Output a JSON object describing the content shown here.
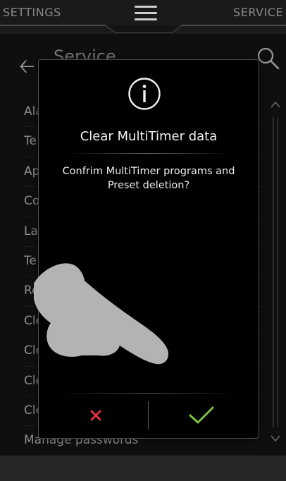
{
  "topbar": {
    "left_tab": "SETTINGS",
    "right_tab": "SERVICE",
    "menu_icon": "hamburger-menu-icon"
  },
  "background": {
    "back_icon": "back-arrow-icon",
    "title": "Service",
    "search_icon": "search-icon",
    "list_items": [
      "Ala",
      "Te",
      "Ap",
      "Co",
      "La",
      "Te",
      "Re",
      "Cle",
      "Cle",
      "Cle",
      "Cle",
      "Manage passwords"
    ]
  },
  "dialog": {
    "icon": "info-icon",
    "title": "Clear MultiTimer data",
    "message": "Confrim MultiTimer programs and Preset deletion?",
    "cancel_icon": "x-icon",
    "confirm_icon": "checkmark-icon",
    "colors": {
      "cancel": "#e8323c",
      "confirm": "#7dc243"
    }
  },
  "overlay": {
    "icon": "pointing-hand-icon"
  }
}
